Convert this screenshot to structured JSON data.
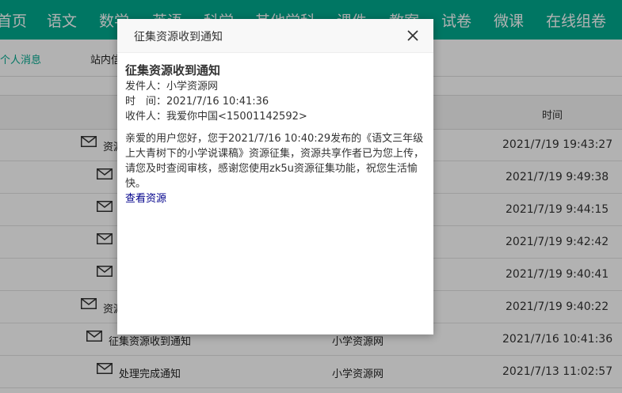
{
  "nav": {
    "items": [
      "首页",
      "语文",
      "数学",
      "英语",
      "科学",
      "其他学科",
      "课件",
      "教案",
      "试卷",
      "微课",
      "在线组卷"
    ]
  },
  "subnav": {
    "items": [
      "个人消息",
      "站内信"
    ]
  },
  "table": {
    "header": {
      "time": "时间"
    },
    "rows": [
      {
        "title": "资源",
        "sender": "",
        "time": "2021/7/19 19:43:27"
      },
      {
        "title": "",
        "sender": "",
        "time": "2021/7/19 9:49:38"
      },
      {
        "title": "",
        "sender": "",
        "time": "2021/7/19 9:44:15"
      },
      {
        "title": "",
        "sender": "",
        "time": "2021/7/19 9:42:42"
      },
      {
        "title": "",
        "sender": "",
        "time": "2021/7/19 9:40:41"
      },
      {
        "title": "资源",
        "sender": "",
        "time": "2021/7/19 9:40:22"
      },
      {
        "title": "征集资源收到通知",
        "sender": "小学资源网",
        "time": "2021/7/16 10:41:36"
      },
      {
        "title": "处理完成通知",
        "sender": "小学资源网",
        "time": "2021/7/13 11:02:57"
      }
    ]
  },
  "modal": {
    "header_title": "征集资源收到通知",
    "close_icon": "close-icon",
    "message_title": "征集资源收到通知",
    "sender": "发件人：小学资源网",
    "time": "时　间：2021/7/16 10:41:36",
    "recipient": "收件人：我爱你中国<15001142592>",
    "content": "亲爱的用户您好，您于2021/7/16 10:40:29发布的《语文三年级上大青树下的小学说课稿》资源征集，资源共享作者已为您上传，请您及时查阅审核，感谢您使用zk5u资源征集功能，祝您生活愉快。",
    "link": "查看资源"
  },
  "colors": {
    "brand": "#00a98f",
    "link": "#00008b"
  }
}
